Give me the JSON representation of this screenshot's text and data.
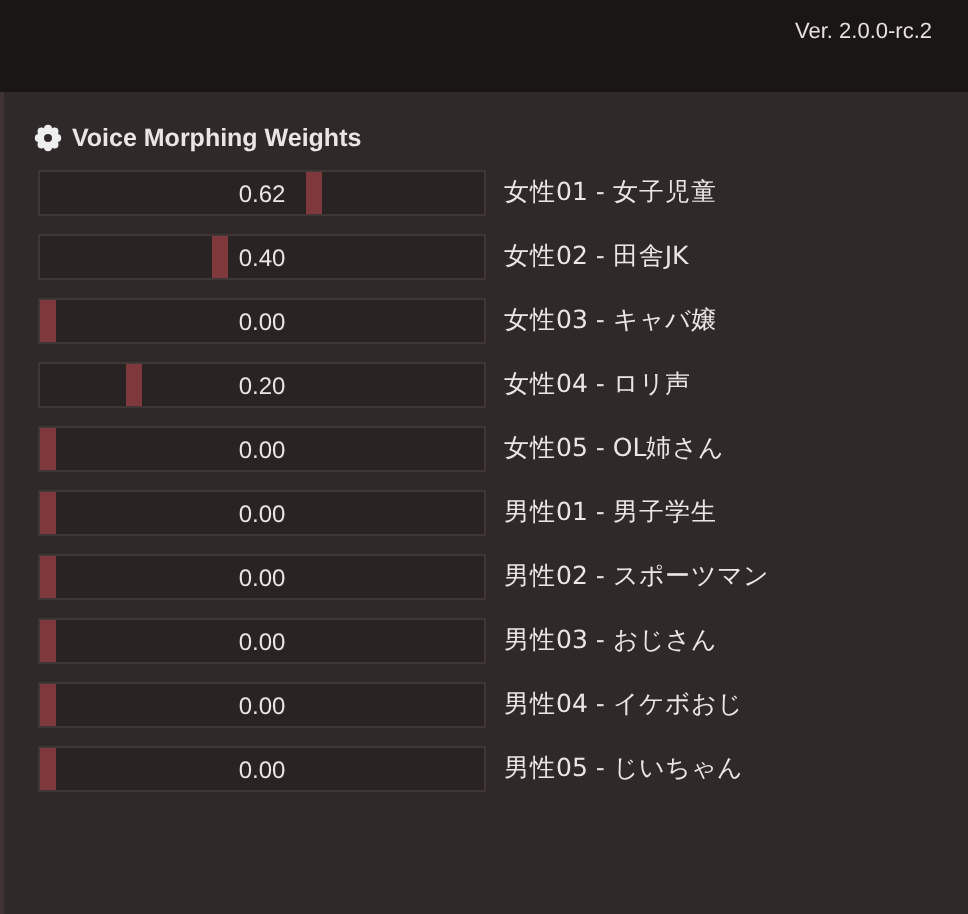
{
  "header": {
    "version": "Ver. 2.0.0-rc.2"
  },
  "panel": {
    "title": "Voice Morphing Weights",
    "weights": [
      {
        "value": "0.62",
        "level": 0.62,
        "label": "女性01 - 女子児童"
      },
      {
        "value": "0.40",
        "level": 0.4,
        "label": "女性02 - 田舎JK"
      },
      {
        "value": "0.00",
        "level": 0,
        "label": "女性03 - キャバ嬢"
      },
      {
        "value": "0.20",
        "level": 0.2,
        "label": "女性04 - ロリ声"
      },
      {
        "value": "0.00",
        "level": 0,
        "label": "女性05 - OL姉さん"
      },
      {
        "value": "0.00",
        "level": 0,
        "label": "男性01 - 男子学生"
      },
      {
        "value": "0.00",
        "level": 0,
        "label": "男性02 - スポーツマン"
      },
      {
        "value": "0.00",
        "level": 0,
        "label": "男性03 - おじさん"
      },
      {
        "value": "0.00",
        "level": 0,
        "label": "男性04 - イケボおじ"
      },
      {
        "value": "0.00",
        "level": 0,
        "label": "男性05 - じいちゃん"
      }
    ]
  }
}
